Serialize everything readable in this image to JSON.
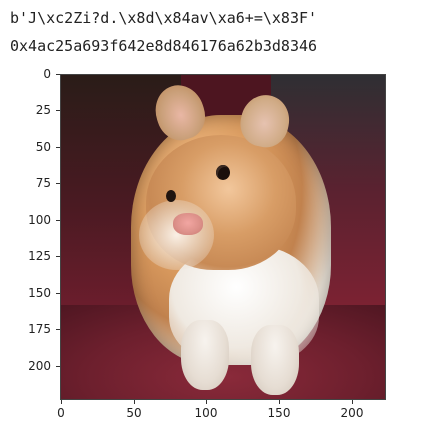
{
  "output": {
    "line1": "b'J\\xc2Zi?d.\\x8d\\x84av\\xa6+=\\x83F'",
    "line2": "0x4ac25a693f642e8d846176a62b3d8346"
  },
  "image_plot": {
    "image": "hamster photograph",
    "x_ticks": [
      "0",
      "50",
      "100",
      "150",
      "200"
    ],
    "y_ticks": [
      "0",
      "25",
      "50",
      "75",
      "100",
      "125",
      "150",
      "175",
      "200"
    ],
    "x_range": [
      0,
      224
    ],
    "y_range": [
      0,
      224
    ]
  }
}
